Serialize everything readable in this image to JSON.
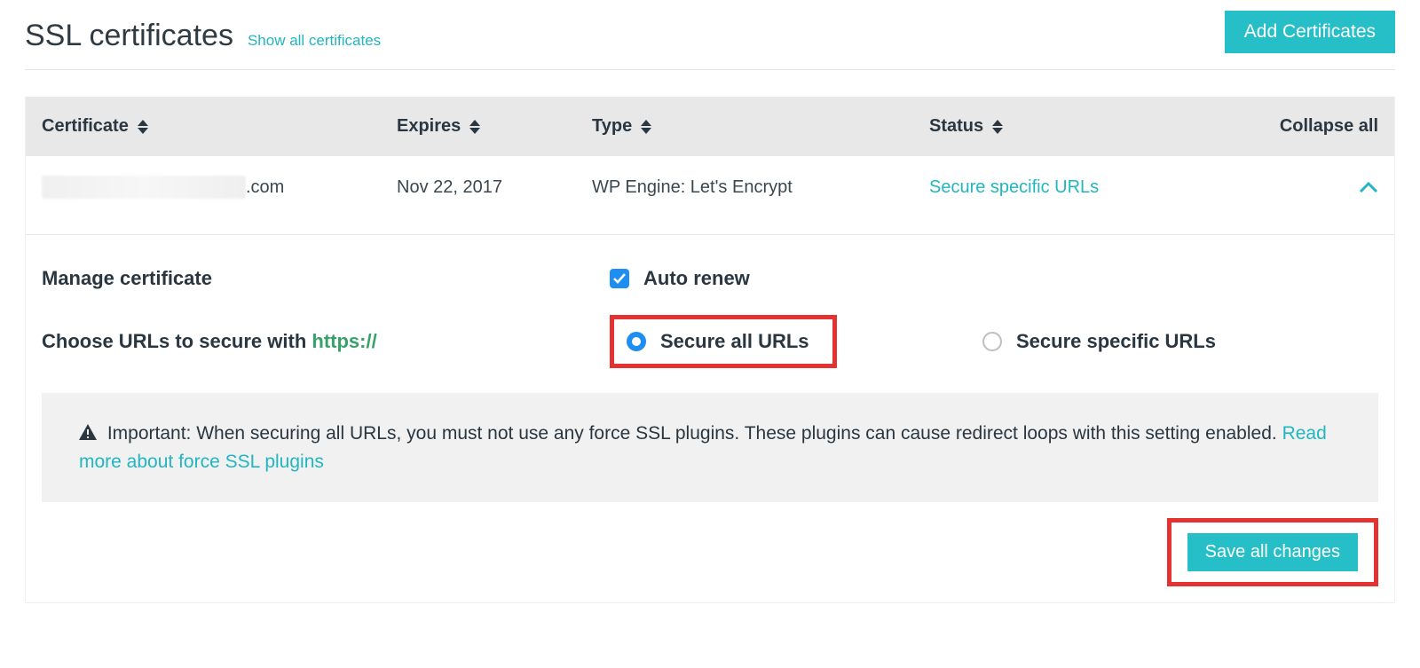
{
  "colors": {
    "accent": "#26bec7",
    "link": "#21b6c1",
    "highlight_border": "#e3322f",
    "checkbox_blue": "#1f8ef1",
    "https_green": "#38a169"
  },
  "header": {
    "title": "SSL certificates",
    "show_all_link": "Show all certificates",
    "add_button": "Add Certificates"
  },
  "table": {
    "columns": {
      "certificate": "Certificate",
      "expires": "Expires",
      "type": "Type",
      "status": "Status",
      "collapse_all": "Collapse all"
    },
    "rows": [
      {
        "domain_suffix": ".com",
        "expires": "Nov 22, 2017",
        "type": "WP Engine: Let's Encrypt",
        "status": "Secure specific URLs",
        "expanded": true
      }
    ]
  },
  "detail": {
    "manage_label": "Manage certificate",
    "auto_renew": {
      "label": "Auto renew",
      "checked": true
    },
    "choose_urls_prefix": "Choose URLs to secure with ",
    "choose_urls_https": "https://",
    "options": {
      "secure_all": "Secure all URLs",
      "secure_specific": "Secure specific URLs",
      "selected": "secure_all"
    },
    "notice": {
      "prefix": "Important: When securing all URLs, you must not use any force SSL plugins. These plugins can cause redirect loops with this setting enabled. ",
      "link_text": "Read more about force SSL plugins"
    },
    "save_button": "Save all changes"
  }
}
